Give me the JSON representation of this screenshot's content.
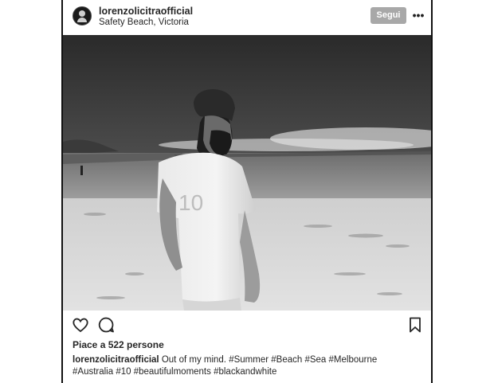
{
  "post": {
    "username": "lorenzolicitraofficial",
    "location": "Safety Beach, Victoria",
    "follow_label": "Segui",
    "more_label": "•••",
    "likes_text": "Piace a 522 persone",
    "caption_user": "lorenzolicitraofficial",
    "caption_text": "Out of my mind.",
    "caption_tags_line1": "#Summer #Beach #Sea #Melbourne",
    "caption_tags_line2": "#Australia #10 #beautifulmoments #blackandwhite",
    "photo_shirt_text": "10",
    "icons": {
      "like": "heart-icon",
      "comment": "comment-icon",
      "save": "bookmark-icon"
    }
  }
}
